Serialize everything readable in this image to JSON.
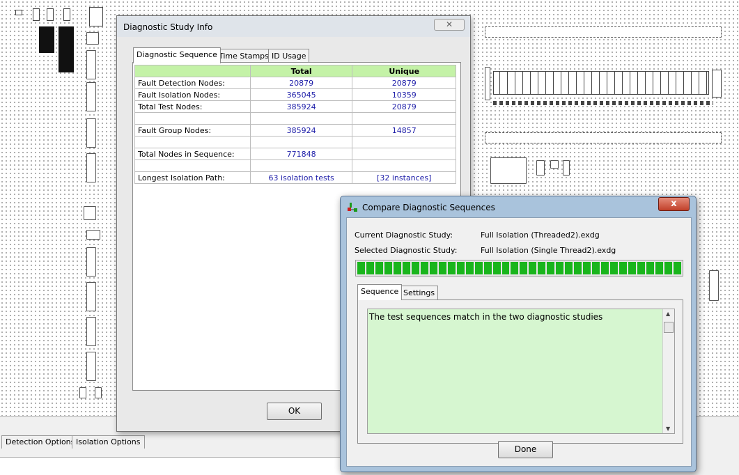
{
  "study_info": {
    "title": "Diagnostic Study Info",
    "close_label": "✕",
    "tabs": [
      "Diagnostic Sequence",
      "Time Stamps",
      "ID Usage"
    ],
    "columns": [
      "",
      "Total",
      "Unique"
    ],
    "rows": [
      {
        "label": "Fault Detection Nodes:",
        "total": "20879",
        "unique": "20879"
      },
      {
        "label": "Fault Isolation Nodes:",
        "total": "365045",
        "unique": "10359"
      },
      {
        "label": "Total Test Nodes:",
        "total": "385924",
        "unique": "20879"
      },
      {
        "label": "",
        "total": "",
        "unique": ""
      },
      {
        "label": "Fault Group Nodes:",
        "total": "385924",
        "unique": "14857"
      },
      {
        "label": "",
        "total": "",
        "unique": ""
      },
      {
        "label": "Total Nodes in Sequence:",
        "total": "771848",
        "unique": ""
      },
      {
        "label": "",
        "total": "",
        "unique": ""
      },
      {
        "label": "Longest Isolation Path:",
        "total": "63 isolation tests",
        "unique": "[32 instances]"
      }
    ],
    "ok_label": "OK"
  },
  "compare": {
    "title": "Compare Diagnostic Sequences",
    "close_label": "x",
    "current_label": "Current Diagnostic Study:",
    "current_value": "Full Isolation (Threaded2).exdg",
    "selected_label": "Selected Diagnostic Study:",
    "selected_value": "Full Isolation (Single Thread2).exdg",
    "progress_fraction": 1.0,
    "progress_color": "#19b51c",
    "tabs": [
      "Sequence",
      "Settings"
    ],
    "result_text": "The test sequences match in the two diagnostic studies",
    "done_label": "Done"
  },
  "bottom_tabs": [
    "Detection Options",
    "Isolation Options"
  ],
  "colors": {
    "header_green": "#c4f2a7",
    "value_blue": "#1c1ca8",
    "text_area_green": "#d6f6d0"
  }
}
